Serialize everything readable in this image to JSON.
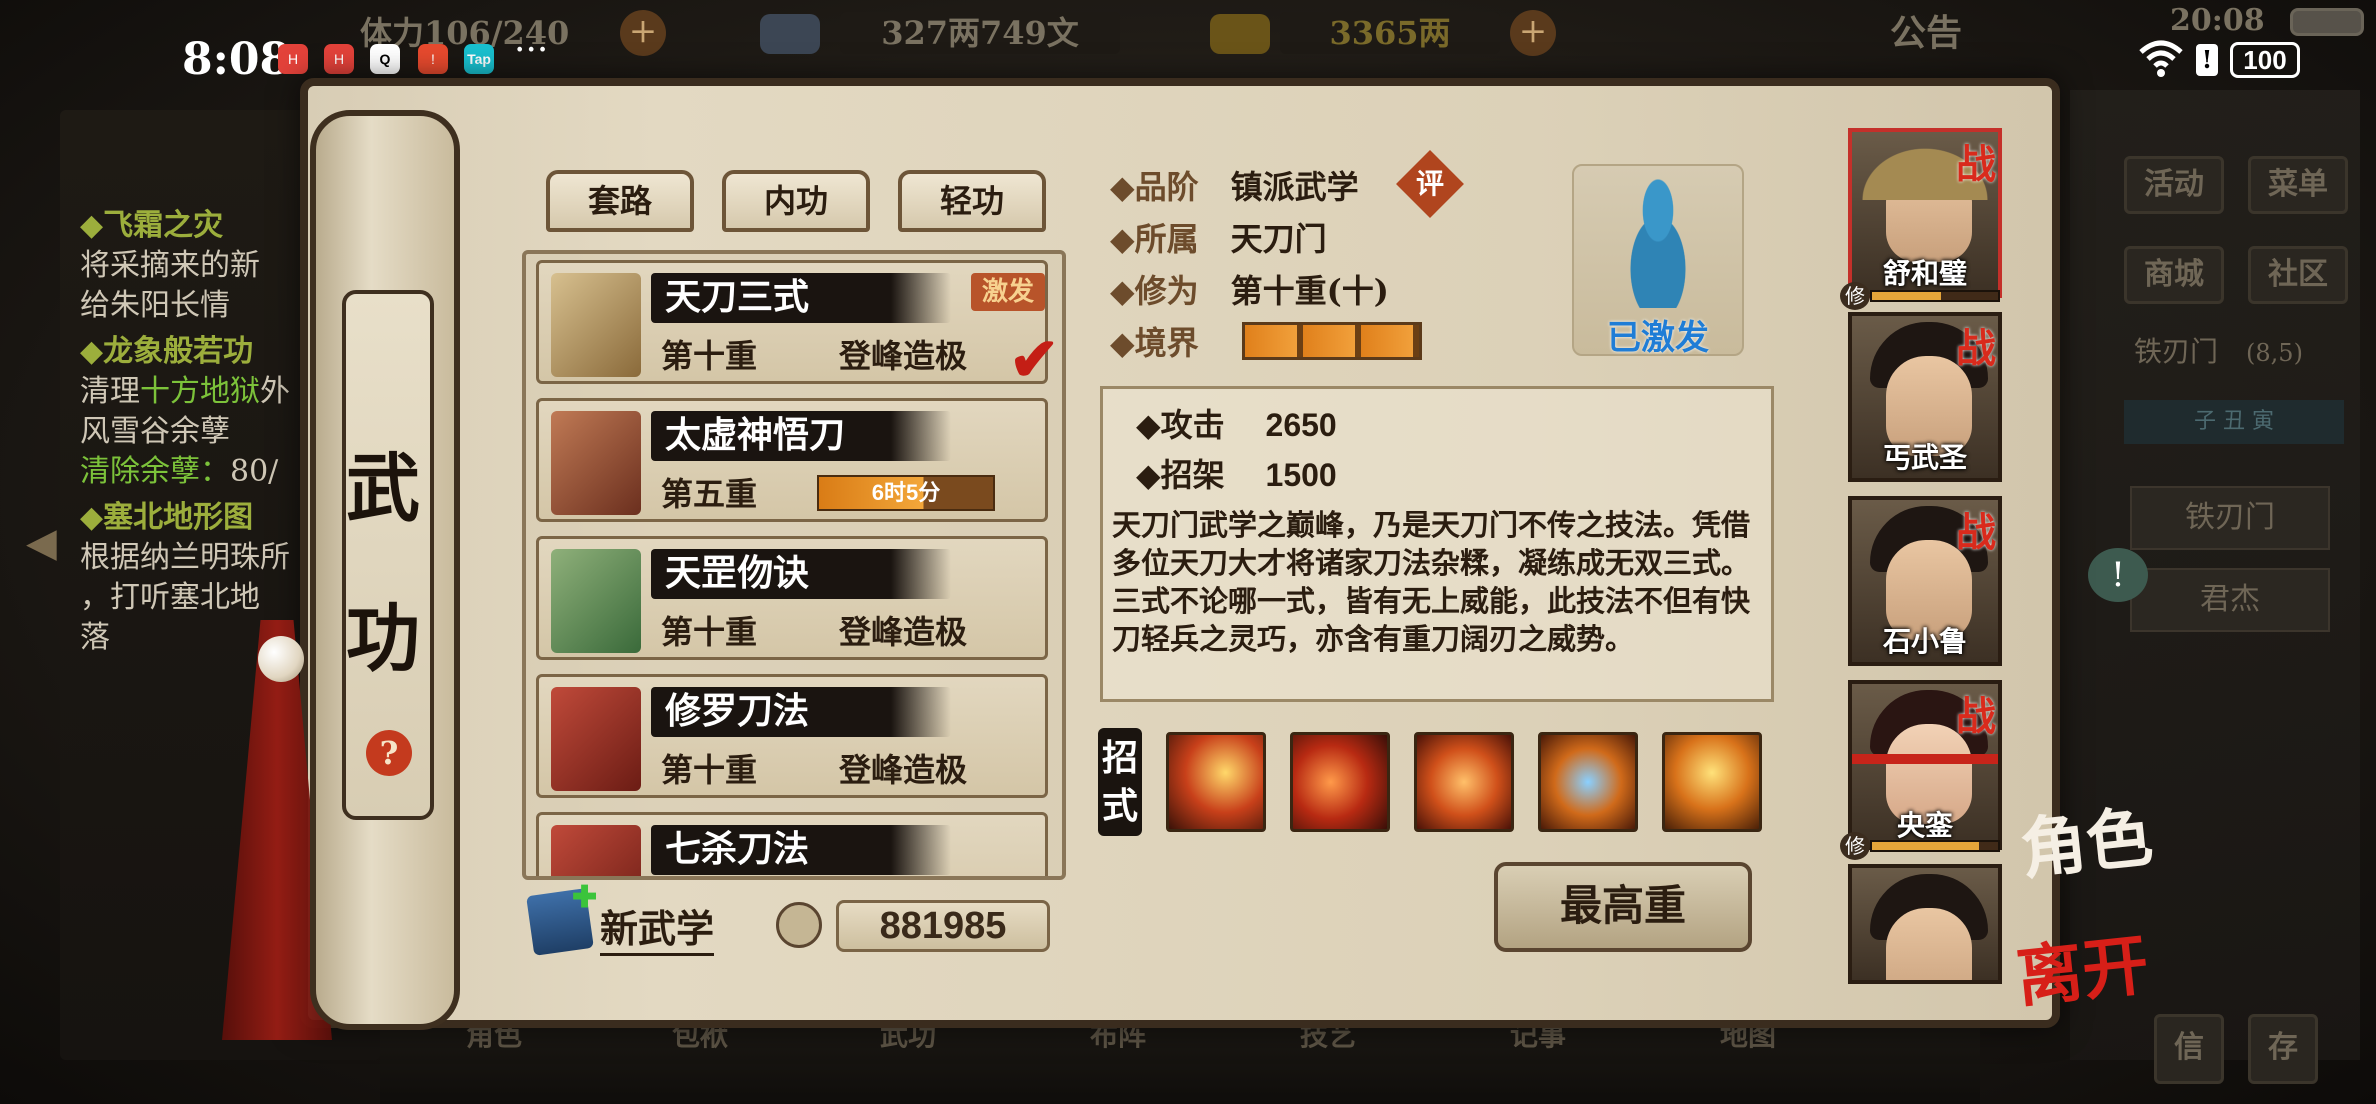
{
  "status_bar": {
    "time": "8:08",
    "battery": "100",
    "app_icons": [
      "huawei-icon",
      "huawei-icon",
      "qq-icon",
      "notification-icon",
      "taptap-icon"
    ],
    "more": "···"
  },
  "top_bar": {
    "stamina": "体力",
    "stamina_value": "106/240",
    "money": "327两749文",
    "gold": "3365两",
    "notice": "公告",
    "game_time": "20:08"
  },
  "side_title": "武功",
  "tabs": [
    "套路",
    "内功",
    "轻功"
  ],
  "skills": [
    {
      "name": "天刀三式",
      "level": "第十重",
      "rank": "登峰造极",
      "badge": "激发"
    },
    {
      "name": "太虚神悟刀",
      "level": "第五重",
      "timer": "6时5分"
    },
    {
      "name": "天罡伆诀",
      "level": "第十重",
      "rank": "登峰造极"
    },
    {
      "name": "修罗刀法",
      "level": "第十重",
      "rank": "登峰造极"
    },
    {
      "name": "七杀刀法"
    }
  ],
  "new_skill_label": "新武学",
  "points": "881985",
  "detail": {
    "grade_label": "◆品阶",
    "grade": "镇派武学",
    "grade_badge": "评",
    "sect_label": "◆所属",
    "sect": "天刀门",
    "cult_label": "◆修为",
    "cult": "第十重(十)",
    "realm_label": "◆境界",
    "realm_fill": 1.0,
    "status": "已激发",
    "attack_label": "◆攻击",
    "attack": "2650",
    "parry_label": "◆招架",
    "parry": "1500",
    "description": "天刀门武学之巅峰，乃是天刀门不传之技法。凭借多位天刀大才将诸家刀法杂糅，凝练成无双三式。三式不论哪一式，皆有无上威能，此技法不但有快刀轻兵之灵巧，亦含有重刀阔刃之威势。",
    "moves_label": "招式",
    "max_button": "最高重"
  },
  "characters": [
    {
      "name": "舒和璧",
      "tag": "战",
      "xiu": "修",
      "progress": 0.55
    },
    {
      "name": "丐武圣",
      "tag": "战"
    },
    {
      "name": "石小鲁",
      "tag": "战"
    },
    {
      "name": "央銮",
      "tag": "战",
      "xiu": "修",
      "progress": 0.85
    },
    {
      "name": ""
    }
  ],
  "right_menu": {
    "activity": "活动",
    "menu": "菜单",
    "shop": "商城",
    "community": "社区",
    "location": "铁刃门",
    "coords": "(8,5)",
    "dial": "子 丑 寅",
    "slot1": "铁刃门",
    "slot2": "君杰",
    "char_btn": "角色",
    "leave_btn": "离开",
    "letter": "信",
    "save": "存"
  },
  "quests": {
    "q1_title": "◆飞霜之灾",
    "q1_line1": "将采摘来的新",
    "q1_line2": "给朱阳长情",
    "q2_title": "◆龙象般若功",
    "q2_line1a": "清理",
    "q2_line1b": "十方地狱",
    "q2_line1c": "外",
    "q2_line2": "风雪谷余孽",
    "q2_line3a": "清除余孽：",
    "q2_line3b": "80/",
    "q3_title": "◆塞北地形图",
    "q3_line1": "根据纳兰明珠所",
    "q3_line2": "，打听塞北地",
    "q3_line3": "落"
  },
  "bottom_nav": [
    "角色",
    "包袱",
    "武功",
    "布阵",
    "技艺",
    "记事",
    "地图"
  ]
}
